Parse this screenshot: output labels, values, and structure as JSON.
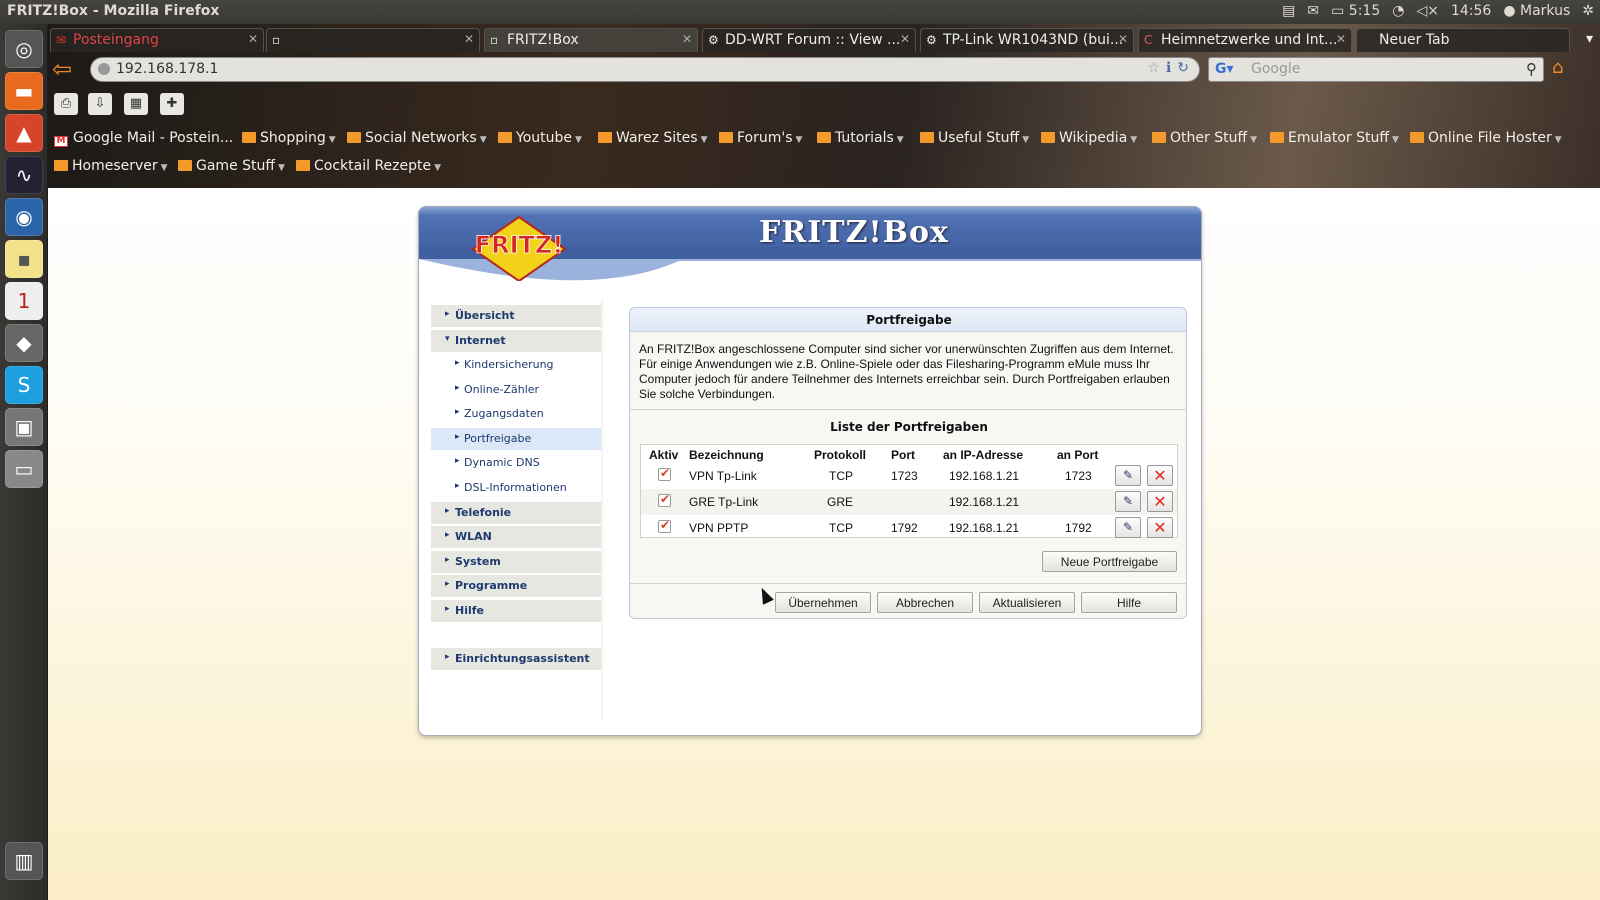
{
  "system": {
    "window_title": "FRITZ!Box - Mozilla Firefox",
    "battery": "5:15",
    "clock": "14:56",
    "user": "Markus"
  },
  "browser": {
    "tabs": [
      {
        "label": "Posteingang",
        "icon": "gmail-icon"
      },
      {
        "label": "",
        "icon": "page-icon"
      },
      {
        "label": "FRITZ!Box",
        "icon": "page-icon"
      },
      {
        "label": "DD-WRT Forum :: View ...",
        "icon": "dd-wrt-icon"
      },
      {
        "label": "TP-Link WR1043ND (bui...",
        "icon": "dd-wrt-icon"
      },
      {
        "label": "Heimnetzwerke und Int...",
        "icon": "c-icon"
      },
      {
        "label": "Neuer Tab",
        "icon": ""
      }
    ],
    "url": "192.168.178.1",
    "search_placeholder": "Google",
    "bookmarks_row1": [
      "Google Mail - Postein...",
      "Shopping",
      "Social Networks",
      "Youtube",
      "Warez Sites",
      "Forum's",
      "Tutorials",
      "Useful Stuff",
      "Wikipedia",
      "Other Stuff",
      "Emulator Stuff",
      "Online File Hoster"
    ],
    "bookmarks_row2": [
      "Homeserver",
      "Game Stuff",
      "Cocktail Rezepte"
    ]
  },
  "fritz": {
    "header_title": "FRITZ!Box",
    "logo_text": "FRITZ!",
    "nav": {
      "uebersicht": "Übersicht",
      "internet": "Internet",
      "kindersicherung": "Kindersicherung",
      "online_zaehler": "Online-Zähler",
      "zugangsdaten": "Zugangsdaten",
      "portfreigabe": "Portfreigabe",
      "dynamic_dns": "Dynamic DNS",
      "dsl_info": "DSL-Informationen",
      "telefonie": "Telefonie",
      "wlan": "WLAN",
      "system": "System",
      "programme": "Programme",
      "hilfe": "Hilfe",
      "einrichtungsassistent": "Einrichtungsassistent"
    },
    "panel": {
      "title": "Portfreigabe",
      "description": "An FRITZ!Box angeschlossene Computer sind sicher vor unerwünschten Zugriffen aus dem Internet. Für einige Anwendungen wie z.B. Online-Spiele oder das Filesharing-Programm eMule muss Ihr Computer jedoch für andere Teilnehmer des Internets erreichbar sein. Durch Portfreigaben erlauben Sie solche Verbindungen.",
      "list_title": "Liste der Portfreigaben",
      "columns": {
        "aktiv": "Aktiv",
        "bezeichnung": "Bezeichnung",
        "protokoll": "Protokoll",
        "port": "Port",
        "ip": "an IP-Adresse",
        "an_port": "an Port"
      },
      "rows": [
        {
          "active": true,
          "name": "VPN Tp-Link",
          "protocol": "TCP",
          "port": "1723",
          "ip": "192.168.1.21",
          "to_port": "1723"
        },
        {
          "active": true,
          "name": "GRE Tp-Link",
          "protocol": "GRE",
          "port": "",
          "ip": "192.168.1.21",
          "to_port": ""
        },
        {
          "active": true,
          "name": "VPN PPTP",
          "protocol": "TCP",
          "port": "1792",
          "ip": "192.168.1.21",
          "to_port": "1792"
        }
      ],
      "new_button": "Neue Portfreigabe",
      "buttons": {
        "apply": "Übernehmen",
        "cancel": "Abbrechen",
        "refresh": "Aktualisieren",
        "help": "Hilfe"
      }
    }
  },
  "colors": {
    "fritz_blue": "#4a6aac",
    "nav_text": "#1e3a6e",
    "accent_orange": "#f08a24",
    "delete_red": "#e02a1a"
  }
}
